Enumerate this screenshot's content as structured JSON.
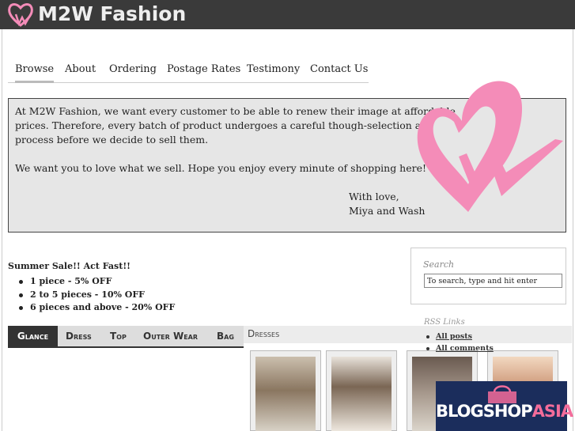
{
  "header": {
    "site_title": "M2W Fashion",
    "logo_icon": "heart-w-logo-icon",
    "background": "#3a3a3a"
  },
  "nav": {
    "items": [
      "Browse",
      "About",
      "Ordering",
      "Postage Rates",
      "Testimony",
      "Contact Us"
    ],
    "active": "Browse"
  },
  "intro": {
    "paragraph1_line1": "At M2W Fashion, we want every customer to be able to renew their image at affordable",
    "paragraph1_line2": "prices. Therefore, every batch of product undergoes a careful though-selection and filtering",
    "paragraph1_line3": "process before we decide to sell them.",
    "paragraph2": "We want you to love what we sell. Hope you enjoy every minute of shopping here!",
    "signoff_line1": "With love,",
    "signoff_line2": "Miya and Wash",
    "accent_color": "#f48cb8"
  },
  "sale": {
    "title": "Summer Sale!! Act Fast!!",
    "items": [
      "1 piece - 5% OFF",
      "2 to 5 pieces - 10% OFF",
      "6 pieces and above - 20% OFF"
    ]
  },
  "search": {
    "label": "Search",
    "value": "To search, type and hit enter"
  },
  "tabs": {
    "items": [
      "Glance",
      "Dress",
      "Top",
      "Outer Wear",
      "Bag"
    ],
    "active": "Glance"
  },
  "dresses": {
    "title": "Dresses"
  },
  "rss": {
    "title": "RSS Links",
    "items": [
      "All posts",
      "All comments"
    ]
  },
  "ad": {
    "text_main": "BLOGSHOP",
    "text_accent": "ASIA",
    "icon": "shopping-bag-icon"
  }
}
